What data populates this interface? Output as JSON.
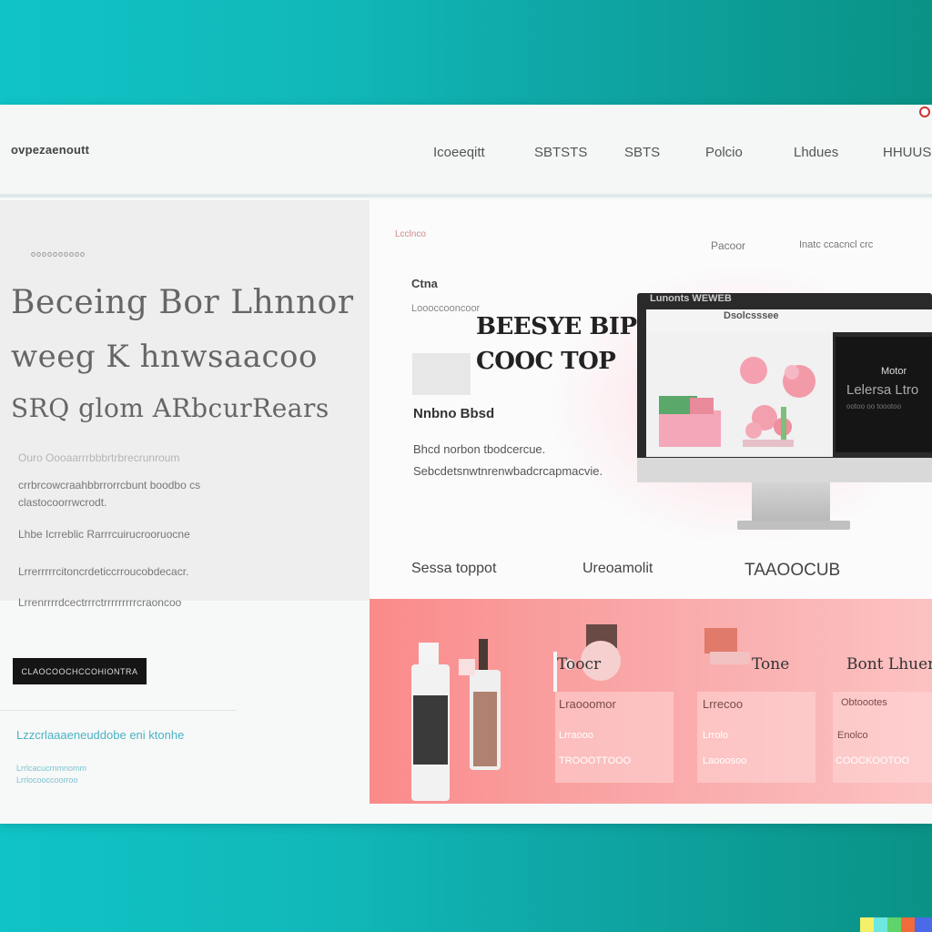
{
  "header": {
    "brand": "ovpezaenoutt",
    "nav": [
      "Icoeeqitt",
      "SBTSTS",
      "SBTS",
      "Polcio",
      "Lhdues",
      "HHUUS"
    ]
  },
  "hero": {
    "eyebrow": "oooooooooo",
    "line1": "Beceing Bor Lhnnor",
    "line2": "weeg K hnwsaacoo",
    "line3": "SRQ glom ARbcurRears",
    "para1": "Ouro Oooaarrrbbbrtrbrecrunroum",
    "para2a": "crrbrcowcraahbbrrorrcbunt boodbo cs",
    "para2b": "clastocoorrwcrodt.",
    "para3": "Lhbe Icrreblic Rarrrcuirucrooruocne",
    "para4a": "Lrrerrrrrcitoncrdeticcrroucobdecacr.",
    "para4b": "Lrrenrrrrdcectrrrctrrrrrrrrrcraoncoo",
    "cta": "CLAOCOOCHCCOHIONTRA",
    "teal_link": "Lzzcrlaaaeneuddobe eni ktonhe",
    "teal_sub1": "Lrrlcacucrnmnomm",
    "teal_sub2": "Lrrlocooccoorroo"
  },
  "middle": {
    "pink_label": "Lcclnco",
    "label_right1": "Pacoor",
    "label_right2": "Inatc ccacncl crc",
    "heading": "Ctna",
    "sub": "Loooccooncoor",
    "title1": "BEESYE BIP",
    "title2": "COOC TOP",
    "caption": "Nnbno Bbsd",
    "body1": "Bhcd norbon tbodcercue.",
    "body2": "Sebcdetsnwtnrenwbadcrcapmacvie.",
    "feature1": "Sessa toppot",
    "feature2": "Ureoamolit",
    "feature3": "TAAOOCUB"
  },
  "monitor": {
    "topbar": "Lunonts  WEWEB",
    "header": "Dsolcsssee",
    "dark_title": "Motor",
    "dark_big": "Lelersa Ltro",
    "dark_small": "ootoo oo toootoo"
  },
  "products": {
    "cards": [
      {
        "title": "Toocr",
        "line1": "Lraooomor",
        "line2": "Lrraooo",
        "line3": "TROOOTTOOO"
      },
      {
        "title": "Tone",
        "line1": "Lrrecoo",
        "line2": "Lrrolo",
        "line3": "Laooosoo"
      },
      {
        "title": "Bont Lhuer",
        "line1": "Obtoootes",
        "line2": "Enolco",
        "line3": "COOCKOOTOO"
      }
    ]
  },
  "colors": {
    "teal": "#10c3c6",
    "pink": "#fb8a8a",
    "cta_bg": "#151515",
    "link_teal": "#4bb3c4"
  }
}
